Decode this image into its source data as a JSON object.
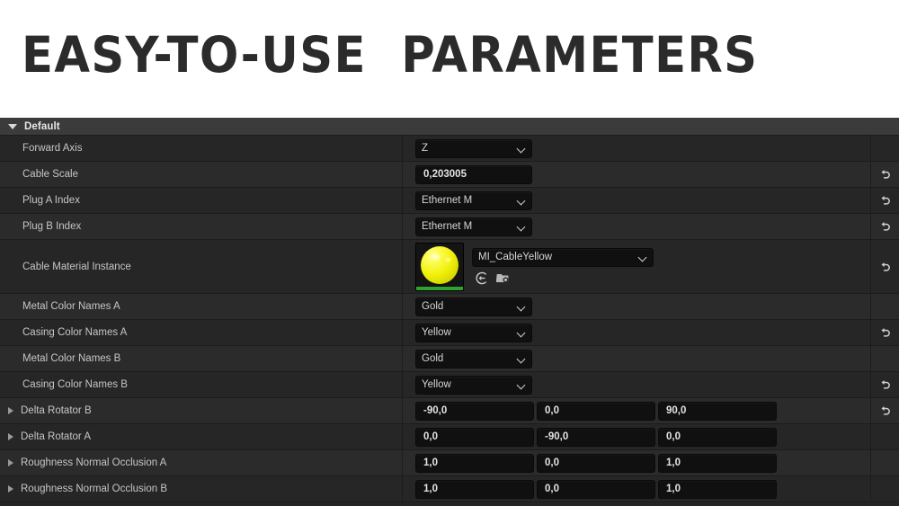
{
  "banner": {
    "title": "EASY-TO-USE  PARAMETERS"
  },
  "panel": {
    "category": {
      "label": "Default",
      "collapse_icon": "triangle-down-icon"
    },
    "icons": {
      "reset": "reset-arrow-icon",
      "use_selected_asset": "use-selected-asset-icon",
      "browse_to_asset": "browse-to-asset-icon",
      "expander": "triangle-right-icon",
      "dropdown": "chevron-down-icon"
    },
    "rows": [
      {
        "name": "Forward Axis",
        "widget": "combo",
        "value": "Z",
        "reset": false,
        "expandable": false
      },
      {
        "name": "Cable Scale",
        "widget": "number",
        "value": "0,203005",
        "reset": true,
        "expandable": false
      },
      {
        "name": "Plug A Index",
        "widget": "combo",
        "value": "Ethernet M",
        "reset": true,
        "expandable": false
      },
      {
        "name": "Plug B Index",
        "widget": "combo",
        "value": "Ethernet M",
        "reset": true,
        "expandable": false
      },
      {
        "name": "Cable Material Instance",
        "widget": "asset",
        "value": "MI_CableYellow",
        "reset": true,
        "expandable": false
      },
      {
        "name": "Metal Color Names A",
        "widget": "combo",
        "value": "Gold",
        "reset": false,
        "expandable": false
      },
      {
        "name": "Casing Color Names A",
        "widget": "combo",
        "value": "Yellow",
        "reset": true,
        "expandable": false
      },
      {
        "name": "Metal Color Names B",
        "widget": "combo",
        "value": "Gold",
        "reset": false,
        "expandable": false
      },
      {
        "name": "Casing Color Names B",
        "widget": "combo",
        "value": "Yellow",
        "reset": true,
        "expandable": false
      },
      {
        "name": "Delta Rotator B",
        "widget": "vector",
        "value": [
          "-90,0",
          "0,0",
          "90,0"
        ],
        "reset": true,
        "expandable": true
      },
      {
        "name": "Delta Rotator A",
        "widget": "vector",
        "value": [
          "0,0",
          "-90,0",
          "0,0"
        ],
        "reset": false,
        "expandable": true
      },
      {
        "name": "Roughness Normal Occlusion A",
        "widget": "vector",
        "value": [
          "1,0",
          "0,0",
          "1,0"
        ],
        "reset": false,
        "expandable": true
      },
      {
        "name": "Roughness Normal Occlusion B",
        "widget": "vector",
        "value": [
          "1,0",
          "0,0",
          "1,0"
        ],
        "reset": false,
        "expandable": true
      }
    ]
  },
  "colors": {
    "page_bg": "#ffffff",
    "title_text": "#2b2b2b",
    "panel_bg": "#242424",
    "row_bg": "#262626",
    "row_bg_alt": "#2b2b2b",
    "category_bg": "#3b3b3b",
    "field_bg": "#101010",
    "label_text": "#c6c6c6",
    "value_text": "#e2e2e2",
    "asset_accent_green": "#2fa32f",
    "asset_sphere_yellow": "#f2f20d"
  }
}
